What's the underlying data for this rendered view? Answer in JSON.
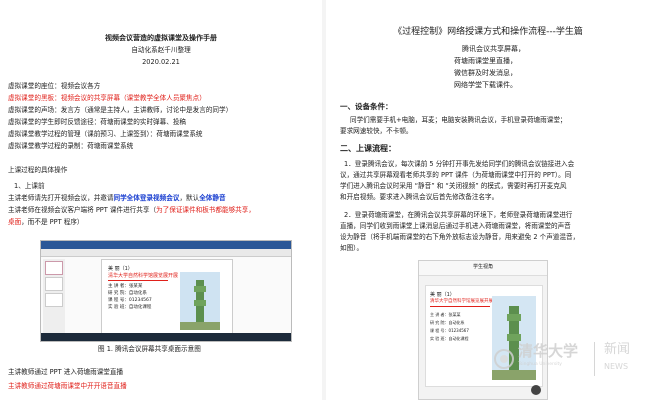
{
  "left": {
    "title": "视频会议营造的虚拟课堂及操作手册",
    "org": "自动化系赵千川整理",
    "date": "2020.02.21",
    "lines": [
      {
        "text": "虚拟课堂的座位：视频会议各方",
        "style": "n"
      },
      {
        "text": "虚拟课堂的黑板：视频会议的共享屏幕（课堂教学全体人员聚焦点）",
        "style": "red"
      },
      {
        "text": "虚拟课堂的声场：发言方（通常是主持人，主讲教师，讨论中是发言的同学）",
        "style": "n"
      },
      {
        "text": "虚拟课堂的学生即时反馈途径：荷塘雨课堂的实时弹幕、投稿",
        "style": "n"
      },
      {
        "text": "虚拟课堂教学过程的管理（课前预习、上课签到）：荷塘雨课堂系统",
        "style": "n"
      },
      {
        "text": "虚拟课堂教学过程的录制：荷塘雨课堂系统",
        "style": "n"
      }
    ],
    "flow_title": "上课过程的具体操作",
    "step1": "1、上课前",
    "p1_a": "主讲老师请先打开视频会议，并邀请",
    "p1_b": "同学全体登录视频会议",
    "p1_c": "，默认",
    "p1_d": "全体静音",
    "p2_a": "主讲老师在视频会议客户端将 PPT 课件进行共享（",
    "p2_b": "为了保证课件和板书都能够共享，",
    "p3_a": "桌面",
    "p3_b": "，而不是 PPT 程序）",
    "fig_caption": "图 1. 腾讯会议屏幕共享桌面示意图",
    "bottom1": "主讲教师通过 PPT 进入荷塘雨课堂直播",
    "bottom2": "主讲教师通过荷塘雨课堂中开开语音直播",
    "slide": {
      "line1": "美 丽（1）",
      "line2": "清华大学自然科学馆展览展开展",
      "items": [
        "主 讲 者：张某某",
        "研 究 院：自动化系",
        "课 程 号：01234567",
        "实 验 班：自动化课程"
      ]
    }
  },
  "right": {
    "title": "《过程控制》网络授课方式和操作流程---学生篇",
    "poem": [
      "腾讯会议共享屏幕，",
      "荷塘雨课堂里直播，",
      "微信群及时发消息，",
      "网络学堂下载课件。"
    ],
    "s1_title": "一、设备条件：",
    "s1_body": [
      "同学们需要手机+电脑，耳麦；电脑安装腾讯会议，手机登录荷塘雨课堂；",
      "要求网速较快，不卡顿。"
    ],
    "s2_title": "二、上课流程：",
    "s2_p1": [
      "1．登录腾讯会议，每次课前 5 分钟打开事先发给同学们的腾讯会议链接进入会",
      "议，通过共享屏幕观看老师共享的 PPT 课件（为荷塘雨课堂中打开的 PPT）。同",
      "学们进入腾讯会议时采用 “静音” 和 “关闭视频” 的模式，需要时再打开麦克风",
      "和开启视频。要求进入腾讯会议后首先修改备注名字。"
    ],
    "s2_p2": [
      "2．登录荷塘雨课堂，在腾讯会议共享屏幕的环境下，老师登录荷塘雨课堂进行",
      "直播，同学们收到雨课堂上课消息后通过手机进入荷塘雨课堂，将雨课堂的声音",
      "设为静音（将手机端雨课堂的右下角外放标志设为静音，用来避免 2 个声道混音，",
      "如图）。"
    ],
    "phone_header": "学生视角",
    "watermark_uni": "清华大学",
    "watermark_en": "Tsinghua University",
    "watermark_news1": "新闻",
    "watermark_news2": "NEWS"
  },
  "colors": {
    "red": "#e0201a",
    "blue": "#1a3fd0",
    "teal": "#2e6f8e"
  }
}
